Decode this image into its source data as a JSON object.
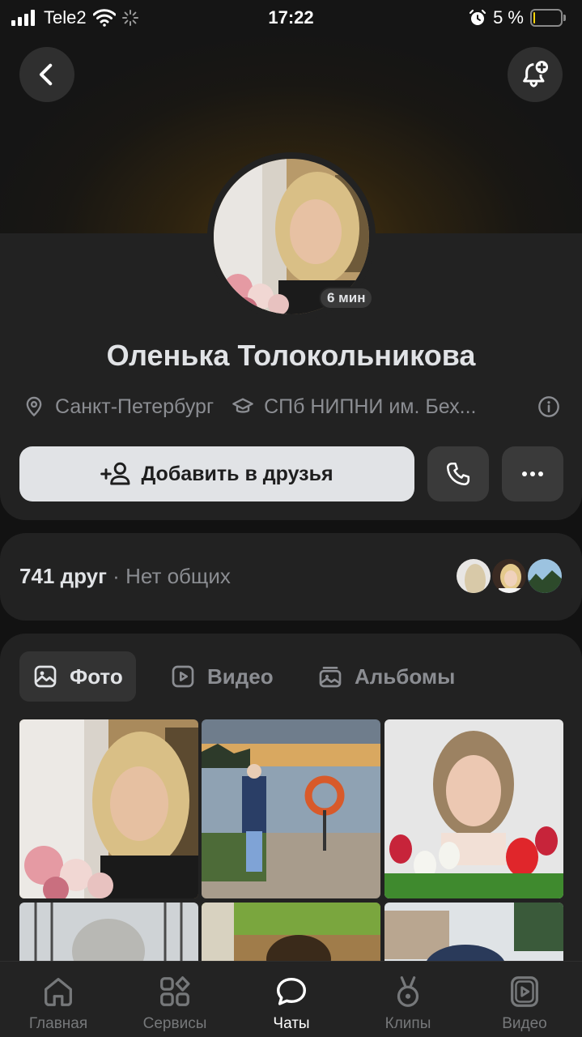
{
  "status_bar": {
    "carrier": "Tele2",
    "time": "17:22",
    "battery_percent": "5 %",
    "battery_level": 0.05
  },
  "header": {
    "back_icon": "chevron-left-icon",
    "notify_icon": "bell-plus-icon"
  },
  "profile": {
    "name": "Оленька Толокольникова",
    "last_seen": "6 мин",
    "city": "Санкт-Петербург",
    "education": "СПб НИПНИ им. Бех...",
    "add_friend_label": "Добавить в друзья"
  },
  "friends": {
    "count": "741 друг",
    "separator": "·",
    "mutual": "Нет общих"
  },
  "media": {
    "tabs": [
      {
        "label": "Фото",
        "icon": "photo-icon",
        "active": true
      },
      {
        "label": "Видео",
        "icon": "video-icon",
        "active": false
      },
      {
        "label": "Альбомы",
        "icon": "albums-icon",
        "active": false
      }
    ]
  },
  "tabbar": {
    "items": [
      {
        "label": "Главная",
        "icon": "home-icon",
        "active": false
      },
      {
        "label": "Сервисы",
        "icon": "services-icon",
        "active": false
      },
      {
        "label": "Чаты",
        "icon": "chat-icon",
        "active": true
      },
      {
        "label": "Клипы",
        "icon": "clips-icon",
        "active": false
      },
      {
        "label": "Видео",
        "icon": "video-icon",
        "active": false
      }
    ]
  },
  "colors": {
    "background": "#121212",
    "card": "#222222",
    "primary_text": "#e1e3e6",
    "secondary_text": "#8b8d92",
    "battery_low": "#ffd60a"
  }
}
